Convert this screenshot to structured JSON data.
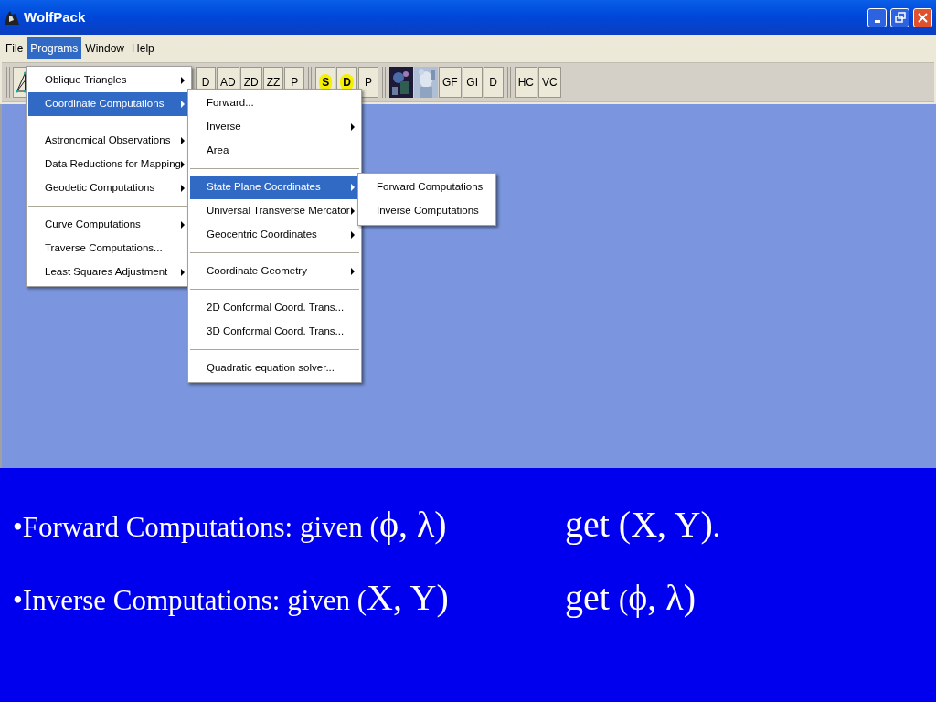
{
  "window": {
    "title": "WolfPack"
  },
  "menu_bar": [
    {
      "label": "File",
      "selected": false
    },
    {
      "label": "Programs",
      "selected": true
    },
    {
      "label": "Window",
      "selected": false
    },
    {
      "label": "Help",
      "selected": false
    }
  ],
  "toolbar": [
    {
      "kind": "drawing"
    },
    {
      "kind": "gap"
    },
    {
      "kind": "text",
      "label": "D"
    },
    {
      "kind": "text",
      "label": "AD"
    },
    {
      "kind": "text",
      "label": "ZD"
    },
    {
      "kind": "text",
      "label": "ZZ"
    },
    {
      "kind": "text",
      "label": "P"
    },
    {
      "kind": "separator"
    },
    {
      "kind": "highlight",
      "label": "S"
    },
    {
      "kind": "highlight",
      "label": "D"
    },
    {
      "kind": "text",
      "label": "P"
    },
    {
      "kind": "separator"
    },
    {
      "kind": "picture"
    },
    {
      "kind": "picture"
    },
    {
      "kind": "text",
      "label": "GF"
    },
    {
      "kind": "text",
      "label": "GI"
    },
    {
      "kind": "text",
      "label": "D"
    },
    {
      "kind": "separator"
    },
    {
      "kind": "text",
      "label": "HC"
    },
    {
      "kind": "text",
      "label": "VC"
    }
  ],
  "menus": [
    {
      "items": [
        {
          "kind": "item",
          "label": "Oblique Triangles",
          "submenu": true,
          "selected": false
        },
        {
          "kind": "item",
          "label": "Coordinate Computations",
          "submenu": true,
          "selected": true
        },
        {
          "kind": "separator"
        },
        {
          "kind": "item",
          "label": "Astronomical Observations",
          "submenu": true,
          "selected": false
        },
        {
          "kind": "item",
          "label": "Data Reductions for Mapping",
          "submenu": true,
          "selected": false
        },
        {
          "kind": "item",
          "label": "Geodetic Computations",
          "submenu": true,
          "selected": false
        },
        {
          "kind": "separator"
        },
        {
          "kind": "item",
          "label": "Curve Computations",
          "submenu": true,
          "selected": false
        },
        {
          "kind": "item",
          "label": "Traverse Computations...",
          "submenu": false,
          "selected": false
        },
        {
          "kind": "item",
          "label": "Least Squares Adjustment",
          "submenu": true,
          "selected": false
        }
      ]
    },
    {
      "items": [
        {
          "kind": "item",
          "label": "Forward...",
          "submenu": false,
          "selected": false
        },
        {
          "kind": "item",
          "label": "Inverse",
          "submenu": true,
          "selected": false
        },
        {
          "kind": "item",
          "label": "Area",
          "submenu": false,
          "selected": false
        },
        {
          "kind": "separator"
        },
        {
          "kind": "item",
          "label": "State Plane Coordinates",
          "submenu": true,
          "selected": true
        },
        {
          "kind": "item",
          "label": "Universal Transverse Mercator",
          "submenu": true,
          "selected": false
        },
        {
          "kind": "item",
          "label": "Geocentric Coordinates",
          "submenu": true,
          "selected": false
        },
        {
          "kind": "separator"
        },
        {
          "kind": "item",
          "label": "Coordinate Geometry",
          "submenu": true,
          "selected": false
        },
        {
          "kind": "separator"
        },
        {
          "kind": "item",
          "label": "2D Conformal Coord. Trans...",
          "submenu": false,
          "selected": false
        },
        {
          "kind": "item",
          "label": "3D Conformal Coord. Trans...",
          "submenu": false,
          "selected": false
        },
        {
          "kind": "separator"
        },
        {
          "kind": "item",
          "label": "Quadratic equation solver...",
          "submenu": false,
          "selected": false
        }
      ]
    },
    {
      "items": [
        {
          "kind": "item",
          "label": "Forward Computations",
          "submenu": false,
          "selected": false
        },
        {
          "kind": "item",
          "label": "Inverse Computations",
          "submenu": false,
          "selected": false
        }
      ]
    }
  ],
  "slide_lines": [
    {
      "given": [
        {
          "kind": "text",
          "text": "•Forward Computations: given ("
        },
        {
          "kind": "symbols",
          "text": "ϕ, λ)"
        }
      ],
      "result": [
        {
          "kind": "symbols",
          "text": "get (X, Y)"
        },
        {
          "kind": "text",
          "text": "."
        }
      ]
    },
    {
      "given": [
        {
          "kind": "text",
          "text": "•Inverse Computations: given ("
        },
        {
          "kind": "symbols",
          "text": "X, Y)"
        }
      ],
      "result": [
        {
          "kind": "symbols",
          "text": "get "
        },
        {
          "kind": "text",
          "text": "("
        },
        {
          "kind": "symbols",
          "text": "ϕ, λ)"
        }
      ]
    }
  ]
}
